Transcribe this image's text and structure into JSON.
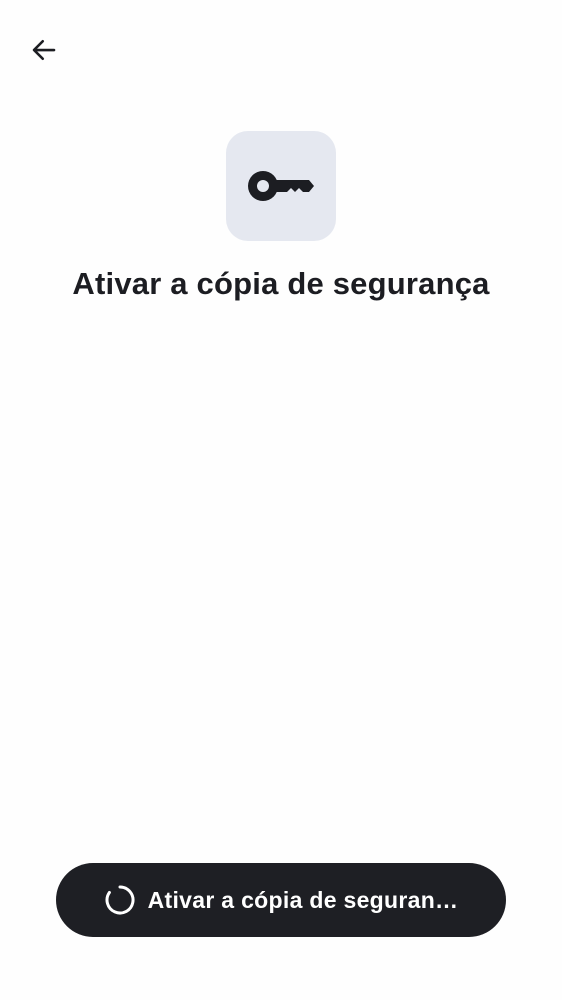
{
  "header": {
    "back_icon": "arrow-left-icon"
  },
  "hero": {
    "icon": "key-icon",
    "tile_color": "#e5e8f0",
    "title": "Ativar a cópia de segurança"
  },
  "footer": {
    "button_label": "Ativar a cópia de seguran…",
    "button_state": "loading",
    "button_color": "#1e1f24",
    "spinner_icon": "spinner-icon"
  }
}
